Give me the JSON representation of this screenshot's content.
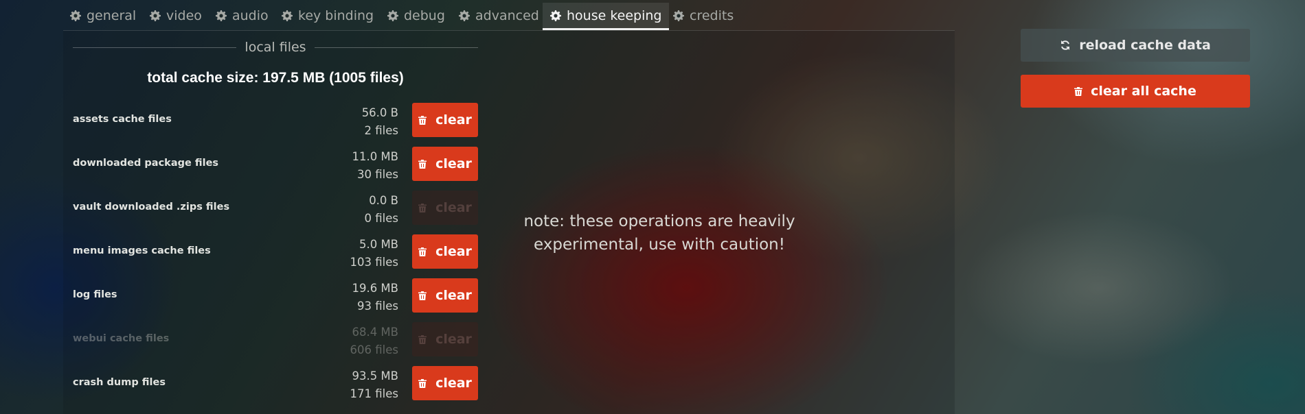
{
  "tabs": [
    {
      "label": "general"
    },
    {
      "label": "video"
    },
    {
      "label": "audio"
    },
    {
      "label": "key binding"
    },
    {
      "label": "debug"
    },
    {
      "label": "advanced"
    },
    {
      "label": "house keeping",
      "active": true
    },
    {
      "label": "credits"
    }
  ],
  "section_title": "local files",
  "total": "total cache size: 197.5 MB (1005 files)",
  "rows": [
    {
      "label": "assets cache files",
      "size": "56.0 B",
      "files": "2 files",
      "button": "clear",
      "enabled": true
    },
    {
      "label": "downloaded package files",
      "size": "11.0 MB",
      "files": "30 files",
      "button": "clear",
      "enabled": true
    },
    {
      "label": "vault downloaded .zips files",
      "size": "0.0 B",
      "files": "0 files",
      "button": "clear",
      "enabled": false
    },
    {
      "label": "menu images cache files",
      "size": "5.0 MB",
      "files": "103 files",
      "button": "clear",
      "enabled": true
    },
    {
      "label": "log files",
      "size": "19.6 MB",
      "files": "93 files",
      "button": "clear",
      "enabled": true
    },
    {
      "label": "webui cache files",
      "size": "68.4 MB",
      "files": "606 files",
      "button": "clear",
      "enabled": false
    },
    {
      "label": "crash dump files",
      "size": "93.5 MB",
      "files": "171 files",
      "button": "clear",
      "enabled": true
    }
  ],
  "note": "note: these operations are heavily experimental, use with caution!",
  "reload_button": "reload cache data",
  "clear_all_button": "clear all cache",
  "colors": {
    "accent": "#d93a1c",
    "reload_bg": "#465052"
  }
}
